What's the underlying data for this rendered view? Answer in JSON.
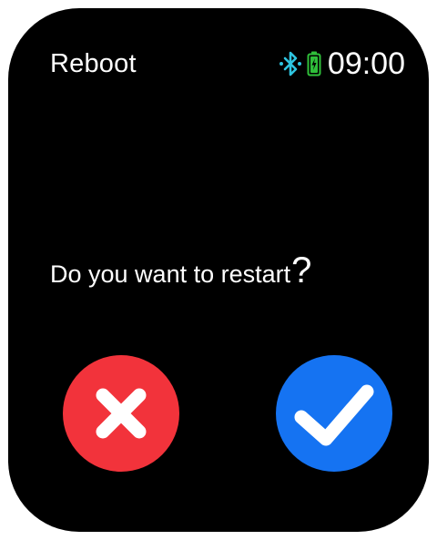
{
  "status_bar": {
    "title": "Reboot",
    "time": "09:00",
    "bluetooth_icon": "bluetooth-icon",
    "battery_icon": "battery-charging-icon"
  },
  "dialog": {
    "question_text": "Do you want to restart",
    "question_mark": "?"
  },
  "actions": {
    "cancel_icon": "close-icon",
    "confirm_icon": "checkmark-icon"
  },
  "colors": {
    "screen_background": "#000000",
    "text": "#ffffff",
    "bluetooth": "#2ec4e0",
    "battery": "#2fbf3a",
    "cancel": "#f2333b",
    "confirm": "#1573f2"
  }
}
